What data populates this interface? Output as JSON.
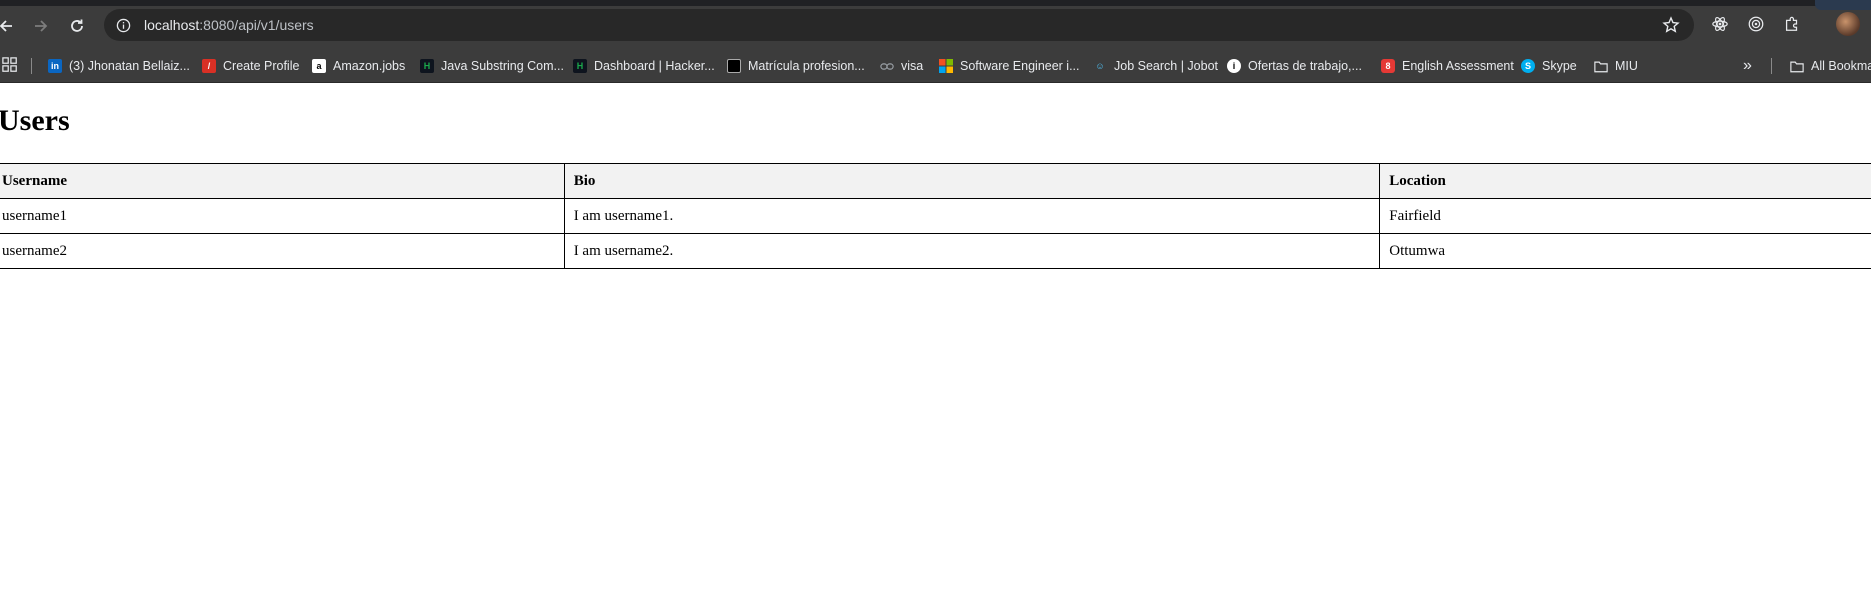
{
  "browser": {
    "url_host": "localhost",
    "url_path": ":8080/api/v1/users",
    "bookmarks": [
      {
        "label": "(3) Jhonatan Bellaiz...",
        "icon": "linkedin-icon",
        "color": "#0a66c2"
      },
      {
        "label": "Create Profile",
        "icon": "red-logo-icon",
        "color": "#d93025"
      },
      {
        "label": "Amazon.jobs",
        "icon": "amazon-icon",
        "color": "#ffffff"
      },
      {
        "label": "Java Substring Com...",
        "icon": "hackerrank-icon",
        "color": "#1ba94c"
      },
      {
        "label": "Dashboard | Hacker...",
        "icon": "hackerrank-icon",
        "color": "#1ba94c"
      },
      {
        "label": "Matrícula profesion...",
        "icon": "shield-logo-icon",
        "color": "#000000"
      },
      {
        "label": "visa",
        "icon": "link-icon",
        "color": "#9aa0a6"
      },
      {
        "label": "Software Engineer i...",
        "icon": "microsoft-icon",
        "color": "#f25022"
      },
      {
        "label": "Job Search | Jobot",
        "icon": "robot-icon",
        "color": "#4fc3f7"
      },
      {
        "label": "Ofertas de trabajo,...",
        "icon": "info-icon",
        "color": "#ffffff"
      },
      {
        "label": "English Assessment",
        "icon": "red-badge-icon",
        "color": "#e53935"
      },
      {
        "label": "Skype",
        "icon": "skype-icon",
        "color": "#00aff0"
      },
      {
        "label": "MIU",
        "icon": "folder-icon",
        "color": "#e8eaed"
      }
    ],
    "more_bookmarks": "»",
    "all_bookmarks": "All Bookmarks"
  },
  "page": {
    "title": "Users",
    "table": {
      "headers": [
        "Username",
        "Bio",
        "Location"
      ],
      "rows": [
        [
          "username1",
          "I am username1.",
          "Fairfield"
        ],
        [
          "username2",
          "I am username2.",
          "Ottumwa"
        ]
      ]
    }
  }
}
